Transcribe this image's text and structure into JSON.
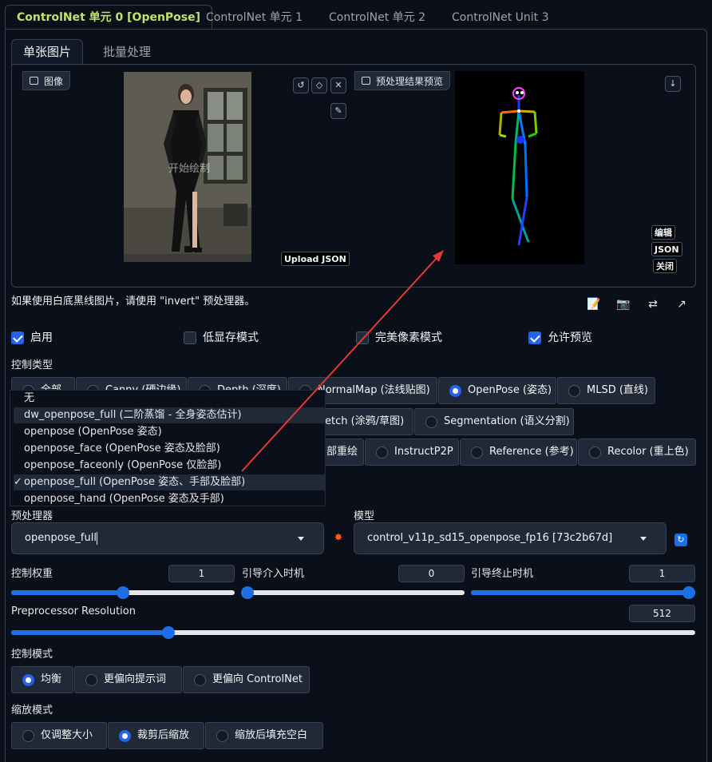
{
  "unit_tabs": [
    "ControlNet 单元 0 [OpenPose]",
    "ControlNet 单元 1",
    "ControlNet 单元 2",
    "ControlNet Unit 3"
  ],
  "image_tabs": [
    "单张图片",
    "批量处理"
  ],
  "input_panel": {
    "label": "图像",
    "watermark": "开始绘制",
    "upload_json": "Upload JSON"
  },
  "preview_panel": {
    "label": "预处理结果预览",
    "edit": "编辑",
    "json": "JSON",
    "close": "关闭"
  },
  "note": "如果使用白底黑线图片，请使用 \"invert\" 预处理器。",
  "checkboxes": [
    {
      "label": "启用",
      "checked": true
    },
    {
      "label": "低显存模式",
      "checked": false
    },
    {
      "label": "完美像素模式",
      "checked": false
    },
    {
      "label": "允许预览",
      "checked": true
    }
  ],
  "control_type": {
    "label": "控制类型",
    "row1": [
      "全部",
      "Canny (硬边缘)",
      "Depth (深度)",
      "NormalMap (法线贴图)",
      "OpenPose (姿态)",
      "MLSD (直线)"
    ],
    "row2": [
      "etch (涂鸦/草图)",
      "Segmentation (语义分割)"
    ],
    "row3": [
      "部重绘",
      "InstructP2P",
      "Reference (参考)",
      "Recolor (重上色)"
    ],
    "selected": "OpenPose (姿态)"
  },
  "preprocessor_dropdown": {
    "options": [
      "无",
      "dw_openpose_full (二阶蒸馏 - 全身姿态估计)",
      "openpose (OpenPose 姿态)",
      "openpose_face (OpenPose 姿态及脸部)",
      "openpose_faceonly (OpenPose 仅脸部)",
      "openpose_full (OpenPose 姿态、手部及脸部)",
      "openpose_hand (OpenPose 姿态及手部)"
    ],
    "checked_mark": "✓"
  },
  "preprocessor": {
    "label": "预处理器",
    "value": "openpose_full"
  },
  "model": {
    "label": "模型",
    "value": "control_v11p_sd15_openpose_fp16 [73c2b67d]"
  },
  "sliders": {
    "weight": {
      "label": "控制权重",
      "value": "1",
      "fraction": 0.5
    },
    "start": {
      "label": "引导介入时机",
      "value": "0",
      "fraction": 0.0
    },
    "end": {
      "label": "引导终止时机",
      "value": "1",
      "fraction": 1.0
    },
    "resolution": {
      "label": "Preprocessor Resolution",
      "value": "512",
      "fraction": 0.23
    }
  },
  "control_mode": {
    "label": "控制模式",
    "options": [
      "均衡",
      "更偏向提示词",
      "更偏向 ControlNet"
    ],
    "selected": "均衡"
  },
  "resize_mode": {
    "label": "缩放模式",
    "options": [
      "仅调整大小",
      "裁剪后缩放",
      "缩放后填充空白"
    ],
    "selected": "裁剪后缩放"
  },
  "colors": {
    "accent": "#2563eb",
    "tab_active": "#c0e46a",
    "background": "#0b0f19",
    "arrow": "#e53935"
  }
}
